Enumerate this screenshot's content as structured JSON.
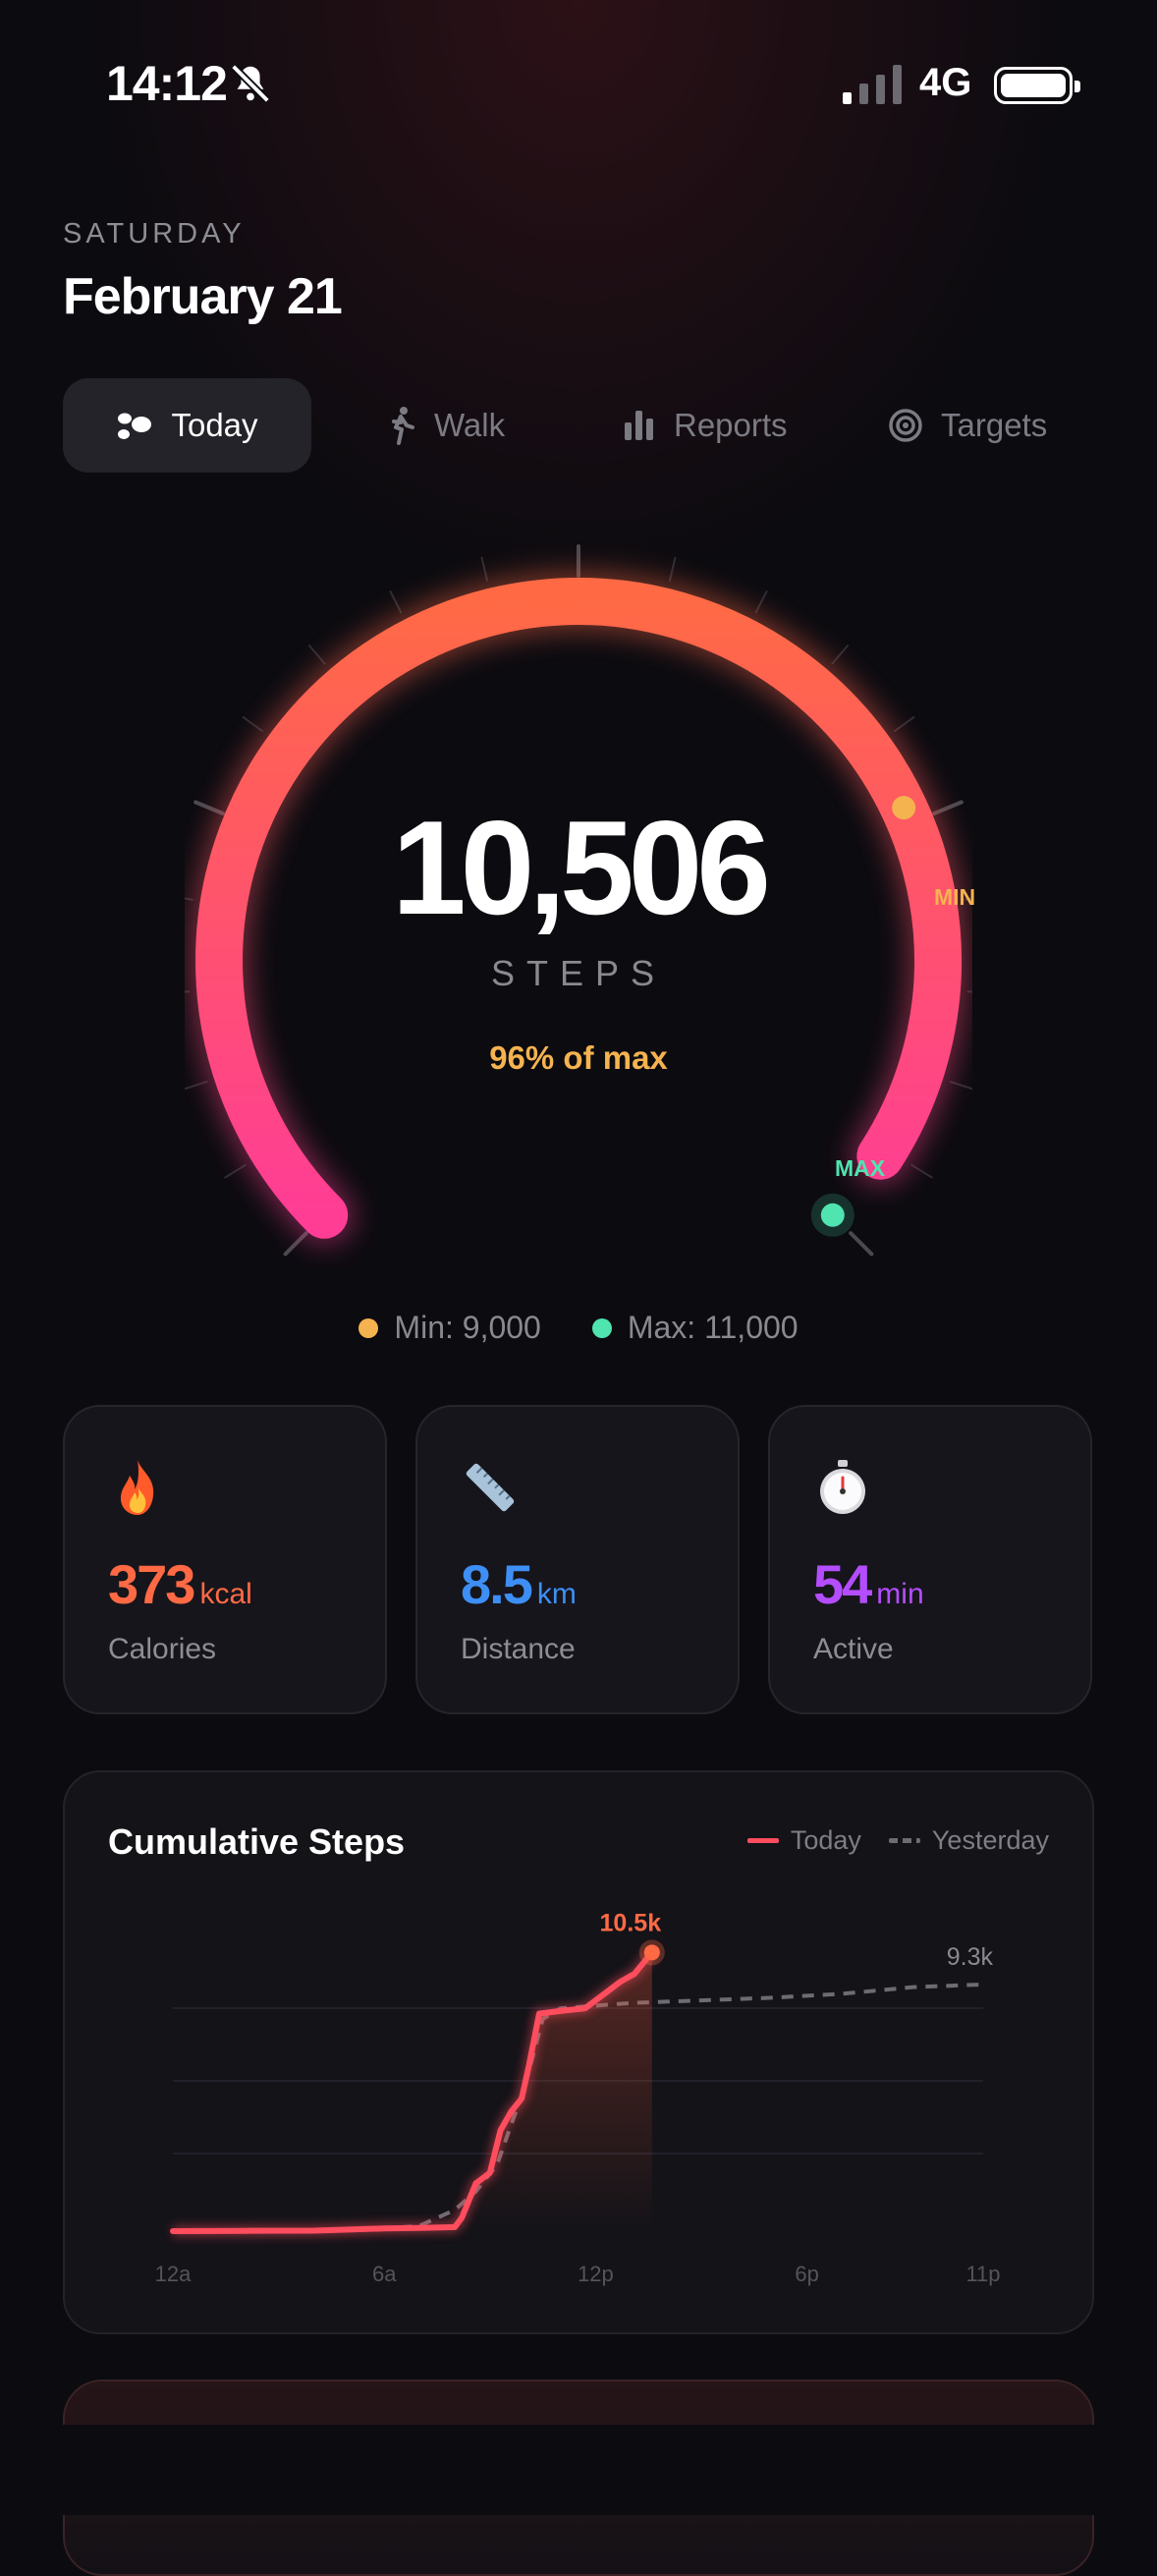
{
  "status_bar": {
    "time": "14:12",
    "network": "4G"
  },
  "header": {
    "day_of_week": "SATURDAY",
    "date": "February 21"
  },
  "tabs": [
    {
      "label": "Today",
      "icon": "footprints-icon",
      "active": true
    },
    {
      "label": "Walk",
      "icon": "walking-icon",
      "active": false
    },
    {
      "label": "Reports",
      "icon": "bar-chart-icon",
      "active": false
    },
    {
      "label": "Targets",
      "icon": "target-icon",
      "active": false
    }
  ],
  "gauge": {
    "steps": "10,506",
    "steps_label": "STEPS",
    "percent_text": "96% of max",
    "min_tag": "MIN",
    "max_tag": "MAX",
    "min_value": 9000,
    "max_value": 11000,
    "current_value": 10506,
    "colors": {
      "arc_start": "#ff6a45",
      "arc_end": "#ff3d95",
      "min": "#f5b34f",
      "max": "#4fe4b0"
    }
  },
  "legend": {
    "min_label": "Min: 9,000",
    "max_label": "Max: 11,000"
  },
  "stats": [
    {
      "icon": "fire-icon",
      "value": "373",
      "unit": "kcal",
      "label": "Calories",
      "color": "#ff6a45"
    },
    {
      "icon": "ruler-icon",
      "value": "8.5",
      "unit": "km",
      "label": "Distance",
      "color": "#3d8ff5"
    },
    {
      "icon": "stopwatch-icon",
      "value": "54",
      "unit": "min",
      "label": "Active",
      "color": "#b44dff"
    }
  ],
  "chart": {
    "title": "Cumulative Steps",
    "legend_today": "Today",
    "legend_yesterday": "Yesterday"
  },
  "chart_data": {
    "type": "line",
    "title": "Cumulative Steps",
    "x_tick_labels": [
      "12a",
      "6a",
      "12p",
      "6p",
      "11p"
    ],
    "x_range": [
      0,
      23
    ],
    "y_range": [
      0,
      11000
    ],
    "grid": true,
    "legend_position": "top-right",
    "series": [
      {
        "name": "Today",
        "color": "#ff4d5e",
        "end_label": "10.5k",
        "points": [
          [
            0,
            0
          ],
          [
            2,
            10
          ],
          [
            4,
            20
          ],
          [
            5,
            60
          ],
          [
            5.5,
            80
          ],
          [
            6,
            100
          ],
          [
            7,
            120
          ],
          [
            8,
            150
          ],
          [
            8.2,
            500
          ],
          [
            8.6,
            1800
          ],
          [
            9,
            2200
          ],
          [
            9.3,
            3800
          ],
          [
            9.6,
            4500
          ],
          [
            9.9,
            5000
          ],
          [
            10.1,
            6200
          ],
          [
            10.4,
            8200
          ],
          [
            11,
            8300
          ],
          [
            11.7,
            8400
          ],
          [
            12.3,
            9000
          ],
          [
            12.7,
            9400
          ],
          [
            13.1,
            9700
          ],
          [
            13.6,
            10506
          ]
        ]
      },
      {
        "name": "Yesterday",
        "color": "#6d6c73",
        "end_label": "9.3k",
        "points": [
          [
            0,
            0
          ],
          [
            4,
            20
          ],
          [
            6,
            100
          ],
          [
            7,
            200
          ],
          [
            8,
            800
          ],
          [
            8.6,
            1500
          ],
          [
            9.2,
            2500
          ],
          [
            9.6,
            4000
          ],
          [
            10,
            5500
          ],
          [
            10.5,
            8000
          ],
          [
            11,
            8400
          ],
          [
            12,
            8500
          ],
          [
            13,
            8600
          ],
          [
            14,
            8650
          ],
          [
            15,
            8700
          ],
          [
            17,
            8800
          ],
          [
            19,
            8950
          ],
          [
            21,
            9200
          ],
          [
            23,
            9300
          ]
        ]
      }
    ]
  },
  "colors": {
    "background": "#0c0b10",
    "card": "#16151b",
    "accent": "#ff5a4f"
  }
}
